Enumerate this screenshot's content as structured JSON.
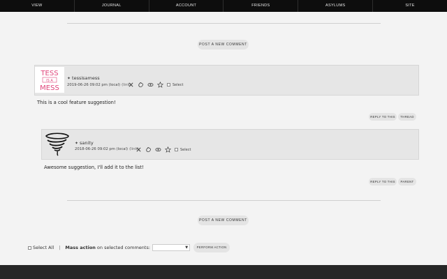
{
  "nav": {
    "items": [
      "VIEW",
      "JOURNAL",
      "ACCOUNT",
      "FRIENDS",
      "ASYLUMS",
      "SITE"
    ]
  },
  "post_comment_label": "POST A NEW COMMENT",
  "comments": [
    {
      "username": "tessisamess",
      "date": "2019-06-26 09:02 pm (local)",
      "link": "(link)",
      "select_label": "Select",
      "text": "This is a cool feature suggestion!",
      "reply_label": "REPLY TO THIS",
      "secondary_label": "THREAD",
      "avatar_text": [
        "TESS",
        "IS A",
        "MESS"
      ]
    },
    {
      "username": "sanity",
      "date": "2018-06-26 09:02 pm (local)",
      "link": "(link)",
      "select_label": "Select",
      "text": "Awesome suggestion, I'll add it to the list!",
      "reply_label": "REPLY TO THIS",
      "secondary_label": "PARENT"
    }
  ],
  "mass": {
    "select_all": "Select All",
    "separator": "|",
    "action_bold": "Mass action",
    "action_rest": "on selected comments:",
    "perform_label": "PERFORM ACTION"
  },
  "colors": {
    "nav_bg": "#0d0d0d",
    "page_bg": "#f3f3f3",
    "comment_bg": "#e6e6e6",
    "avatar_pink": "#e0457b",
    "footer_bg": "#262626"
  }
}
